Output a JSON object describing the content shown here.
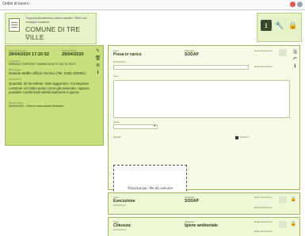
{
  "window": {
    "title": "Ordini di lavoro"
  },
  "header": {
    "subject": "Trasporto/Smaltimento sabbie stradali + Ritiro con consegna container",
    "municipality": "COMUNE DI TRE VILLE",
    "id": "105"
  },
  "tools": {
    "download_icon": "download-icon",
    "wrench_icon": "wrench-icon",
    "lock_icon": "lock-icon"
  },
  "order": {
    "date_label": "Data inserimento",
    "date_value": "29/04/2020 17:20:52",
    "due_label": "Data richiesta",
    "due_value": "29/04/2020",
    "contractor_label": "Contraente",
    "contractor_value": "ANDREA CONSTANT GIANNI DA ALTO VAL DI SOLE",
    "reference_label": "Riferimento",
    "reference_value": "Daniele Maffei Ufficio Tecnico (Tel. 0465 329351)",
    "notes_label": "Annotazioni",
    "notes_value": "Quantità: 20 tonnellate; Note aggiuntive: Consegnare container nel solito posto come già avvenuto. Appena possibile Confermare telefonicamente il giorno.",
    "planning_label": "Pianificazione",
    "planning_value": "30/04/2020 - Giorno esecuzione tentativo"
  },
  "phase_main": {
    "phase_label": "Fase",
    "phase_value": "Presa in carico",
    "material_label": "Materiale",
    "material_value": "SODAP",
    "exec_label": "Data esecuzione",
    "desc_label": "Descrizione",
    "invoice_label": "Data fatturazione",
    "note_label": "Note",
    "unit_label": "Unità",
    "attachments_label": "Allegati",
    "public_label": "Pubblico",
    "dropzone_text": "Trascina qui i file da caricare"
  },
  "phase_2": {
    "phase_label": "Fase",
    "phase_value": "Esecuzione",
    "material_label": "Materiale",
    "material_value": "SODAP",
    "exec_label": "Data esecuzione",
    "desc_label": "Descrizione",
    "invoice_label": "Data fatturazione"
  },
  "phase_3": {
    "phase_label": "Fase",
    "phase_value": "Chiusura",
    "material_label": "Materiale",
    "material_value": "Igiene ambientale",
    "exec_label": "Data esecuzione",
    "desc_label": "Descrizione",
    "invoice_label": "Data fatturazione"
  },
  "colors": {
    "accent": "#c7e07d",
    "card": "#e6f3c8",
    "dark": "#3c4a30"
  }
}
